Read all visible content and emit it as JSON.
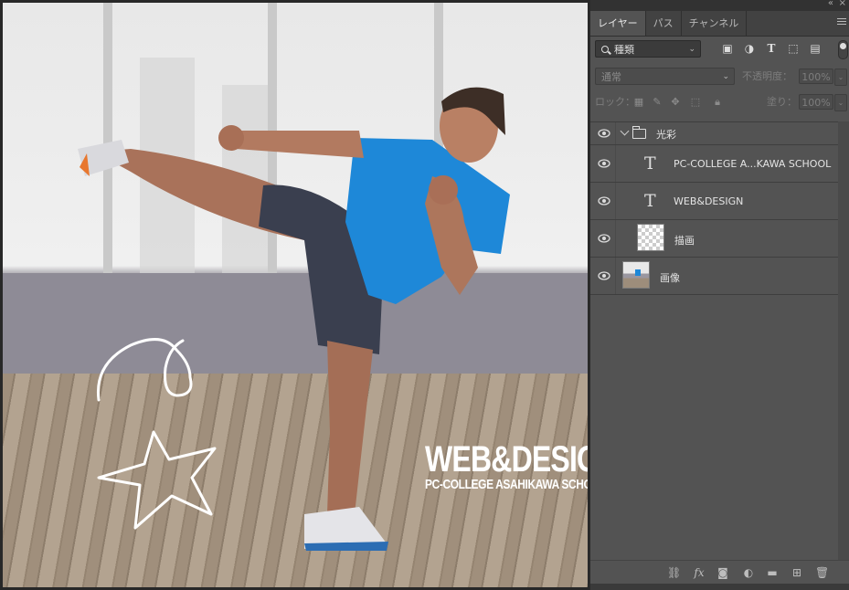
{
  "canvas": {
    "overlay_title": "WEB&DESIGN",
    "overlay_subtitle": "PC-COLLEGE ASAHIKAWA SCHOOL"
  },
  "panel": {
    "tabs": [
      {
        "label": "レイヤー",
        "active": true
      },
      {
        "label": "パス",
        "active": false
      },
      {
        "label": "チャンネル",
        "active": false
      }
    ],
    "filter_kind": "種類",
    "blend_mode": "通常",
    "opacity_label": "不透明度：",
    "opacity_value": "100%",
    "lock_label": "ロック：",
    "fill_label": "塗り：",
    "fill_value": "100%",
    "layers": [
      {
        "name": "光彩",
        "kind": "group"
      },
      {
        "name": "PC-COLLEGE A...KAWA SCHOOL",
        "kind": "text"
      },
      {
        "name": "WEB&DESIGN",
        "kind": "text"
      },
      {
        "name": "描画",
        "kind": "empty"
      },
      {
        "name": "画像",
        "kind": "image"
      }
    ],
    "filter_icons": [
      "image-filter-icon",
      "adjustment-filter-icon",
      "type-filter-icon",
      "shape-filter-icon",
      "smart-object-filter-icon"
    ],
    "lock_icons": [
      "lock-transparent-icon",
      "lock-paint-icon",
      "lock-position-icon",
      "lock-artboard-icon",
      "lock-all-icon"
    ],
    "bottom_icons": [
      "link-icon",
      "fx-icon",
      "mask-icon",
      "adjustment-icon",
      "new-group-icon",
      "new-layer-icon",
      "trash-icon"
    ]
  },
  "colors": {
    "shirt": "#1e88d8",
    "panel_bg": "#535353",
    "tab_bar": "#424242"
  }
}
